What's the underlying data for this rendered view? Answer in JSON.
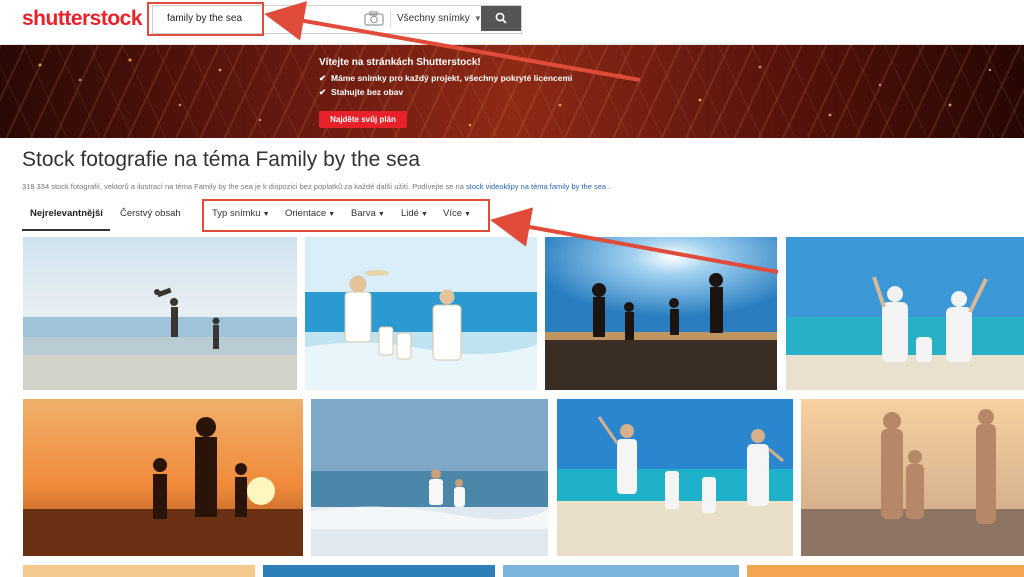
{
  "header": {
    "logo": "shutterstock",
    "search_value": "family by the sea",
    "type_select": "Všechny snímky",
    "camera_icon": "camera-icon",
    "search_icon": "magnifier-icon"
  },
  "banner": {
    "title": "Vítejte na stránkách Shutterstock!",
    "bullets": [
      "Máme snímky pro každý projekt, všechny pokryté licencemi",
      "Stahujte bez obav"
    ],
    "cta": "Najděte svůj plán"
  },
  "main": {
    "title": "Stock fotografie na téma Family by the sea",
    "subtitle_prefix": "318 334 stock fotografií, vektorů a ilustrací na téma Family by the sea je k dispozici bez poplatků za každé další užití. Podívejte se na ",
    "subtitle_link": "stock videoklipy na téma family by the sea",
    "subtitle_suffix": " .",
    "tabs": [
      {
        "label": "Nejrelevantnější",
        "active": true
      },
      {
        "label": "Čerstvý obsah",
        "active": false
      }
    ],
    "filters": [
      "Typ snímku",
      "Orientace",
      "Barva",
      "Lidé",
      "Více"
    ]
  },
  "colors": {
    "brand": "#e8222b",
    "annotation": "#e04b3a",
    "link": "#2a66b0"
  }
}
